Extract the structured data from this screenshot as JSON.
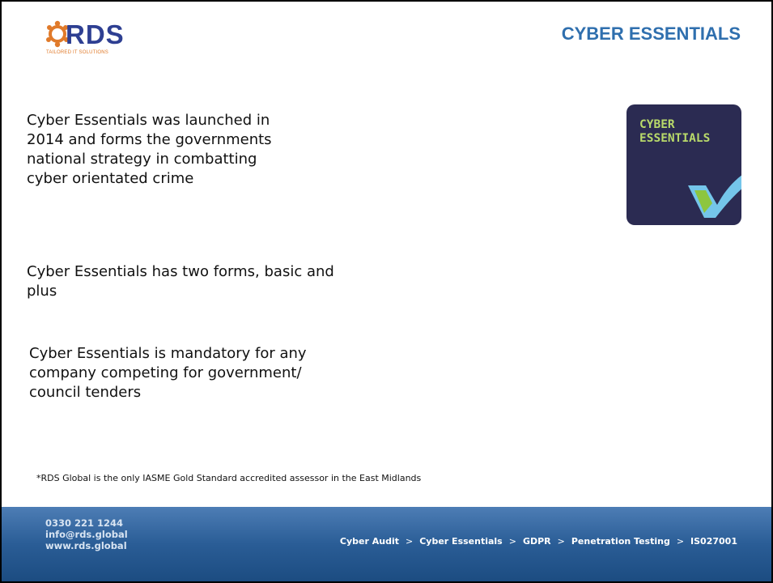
{
  "header": {
    "logo_text": "RDS",
    "logo_tagline": "TAILORED IT SOLUTIONS",
    "title": "CYBER ESSENTIALS"
  },
  "body": {
    "paragraph_1": "Cyber Essentials was launched in 2014 and forms the governments national strategy in combatting cyber orientated crime",
    "paragraph_2": "Cyber Essentials has two forms, basic and plus",
    "paragraph_3": "Cyber Essentials is mandatory for any company competing for government/ council tenders",
    "footnote": "*RDS Global is the only IASME Gold Standard accredited assessor in the East Midlands"
  },
  "badge": {
    "line_1": "CYBER",
    "line_2": "ESSENTIALS",
    "background_color": "#2b2b52",
    "text_color": "#b8d96a",
    "tick_color": "#74c5ea"
  },
  "footer": {
    "phone": "0330 221 1244",
    "email": "info@rds.global",
    "website": "www.rds.global",
    "services": [
      "Cyber Audit",
      "Cyber Essentials",
      "GDPR",
      "Penetration Testing",
      "IS027001"
    ],
    "separator": ">"
  },
  "colors": {
    "title": "#2f6fae",
    "logo_blue": "#2e3f92",
    "logo_orange": "#e07a2a",
    "footer_top": "#4d7db5",
    "footer_bottom": "#1c4c81"
  }
}
